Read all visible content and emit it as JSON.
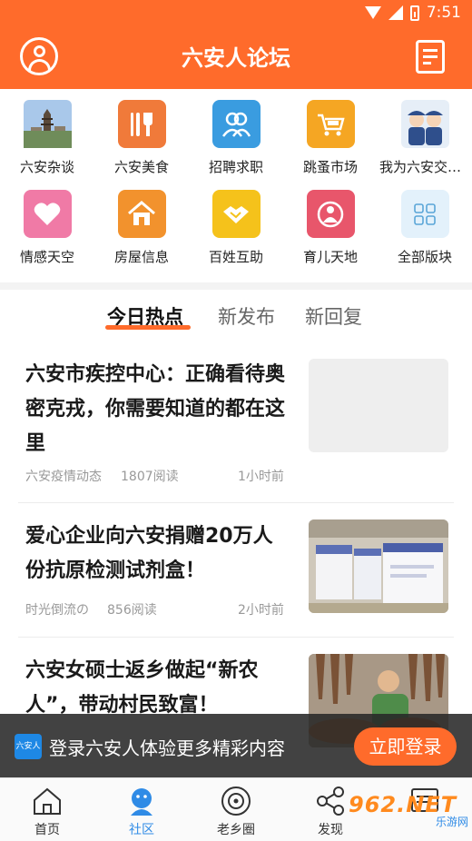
{
  "status_bar": {
    "time": "7:51"
  },
  "header": {
    "title": "六安人论坛"
  },
  "categories": [
    {
      "label": "六安杂谈",
      "icon": "pagoda-photo-icon",
      "color": "#8fb3d9"
    },
    {
      "label": "六安美食",
      "icon": "fork-knife-icon",
      "color": "#f07a3a"
    },
    {
      "label": "招聘求职",
      "icon": "people-icon",
      "color": "#3a9ce0"
    },
    {
      "label": "跳蚤市场",
      "icon": "cart-icon",
      "color": "#f5a623"
    },
    {
      "label": "我为六安交通...",
      "icon": "police-photo-icon",
      "color": "#5a7ec0"
    },
    {
      "label": "情感天空",
      "icon": "heart-icon",
      "color": "#f07aa6"
    },
    {
      "label": "房屋信息",
      "icon": "house-icon",
      "color": "#f2922d"
    },
    {
      "label": "百姓互助",
      "icon": "handshake-icon",
      "color": "#f5c21b"
    },
    {
      "label": "育儿天地",
      "icon": "baby-icon",
      "color": "#e8566b"
    },
    {
      "label": "全部版块",
      "icon": "grid-icon",
      "color": "#e3f1fb"
    }
  ],
  "tabs": [
    "今日热点",
    "新发布",
    "新回复"
  ],
  "articles": [
    {
      "title": "六安市疾控中心：正确看待奥密克戎，你需要知道的都在这里",
      "source": "六安疫情动态",
      "views": "1807阅读",
      "time": "1小时前"
    },
    {
      "title": "爱心企业向六安捐赠20万人份抗原检测试剂盒！",
      "source": "时光倒流の",
      "views": "856阅读",
      "time": "2小时前"
    },
    {
      "title": "六安女硕士返乡做起“新农人”，带动村民致富！",
      "source": "",
      "views": "",
      "time": ""
    }
  ],
  "login_banner": {
    "logo_text": "六安人",
    "text": "登录六安人体验更多精彩内容",
    "button": "立即登录"
  },
  "bottom_nav": [
    {
      "label": "首页",
      "icon": "home-icon"
    },
    {
      "label": "社区",
      "icon": "community-icon"
    },
    {
      "label": "老乡圈",
      "icon": "circle-icon"
    },
    {
      "label": "发现",
      "icon": "share-icon"
    },
    {
      "label": "",
      "icon": "message-icon"
    }
  ],
  "watermark": {
    "top": "962.NET",
    "bottom": "乐游网"
  }
}
